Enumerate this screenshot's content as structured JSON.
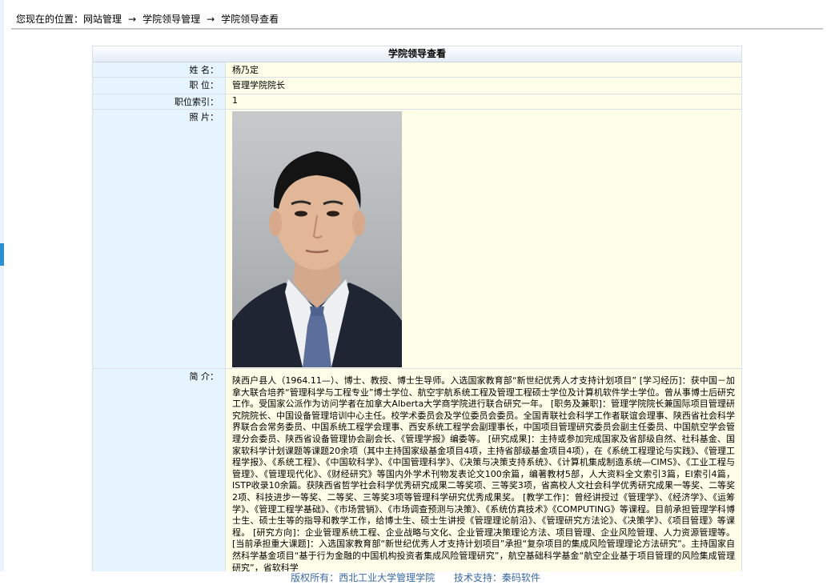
{
  "breadcrumb": {
    "prefix": "您现在的位置：",
    "items": [
      "网站管理",
      "学院领导管理",
      "学院领导查看"
    ],
    "separator": "→"
  },
  "panel": {
    "title": "学院领导查看",
    "fields": {
      "name_label": "姓    名：",
      "name_value": "杨乃定",
      "position_label": "职    位：",
      "position_value": "管理学院院长",
      "index_label": "职位索引：",
      "index_value": "1",
      "photo_label": "照    片：",
      "intro_label": "简    介：",
      "intro_value": "陕西户县人（1964.11—）、博士、教授、博士生导师。入选国家教育部“新世纪优秀人才支持计划项目” [学习经历]：获中国－加拿大联合培养“管理科学与工程专业”博士学位、航空宇航系统工程及管理工程硕士学位及计算机软件学士学位。曾从事博士后研究工作。受国家公派作为访问学者在加拿大Alberta大学商学院进行联合研究一年。 [职务及兼职]：管理学院院长兼国际项目管理研究院院长、中国设备管理培训中心主任。校学术委员会及学位委员会委员。全国青联社会科学工作者联谊会理事、陕西省社会科学界联合会常务委员、中国系统工程学会理事、西安系统工程学会副理事长，中国项目管理研究委员会副主任委员、中国航空学会管理分会委员、陕西省设备管理协会副会长、《管理学报》编委等。 [研究成果]：主持或参加完成国家及省部级自然、社科基金、国家软科学计划课题等课题20余项（其中主持国家级基金项目4项，主持省部级基金项目4项），在《系统工程理论与实践》、《管理工程学报》、《系统工程》、《中国软科学》、《中国管理科学》、《决策与决策支持系统》、《计算机集成制造系统—CIMS》、《工业工程与管理》、《管理现代化》、《财经研究》等国内外学术刊物发表论文100余篇，编著教材5部，人大资料全文索引3篇，EI索引4篇，ISTP收录10余篇。获陕西省哲学社会科学优秀研究成果二等奖项、三等奖3项，省高校人文社会科学优秀研究成果一等奖、二等奖2项、科技进步一等奖、二等奖、三等奖3项等管理科学研究优秀成果奖。 [教学工作]：曾经讲授过《管理学》、《经济学》、《运筹学》、《管理工程学基础》、《市场营销》、《市场调查预测与决策》、《系统仿真技术》《COMPUTING》等课程。目前承担管理学科博士生、硕士生等的指导和教学工作，给博士生、硕士生讲授《管理理论前沿》、《管理研究方法论》、《决策学》、《项目管理》等课程。 [研究方向]：企业管理系统工程、企业战略与文化、企业管理决策理论方法、项目管理、企业风险管理、人力资源管理等。 [当前承担重大课题]：入选国家教育部“新世纪优秀人才支持计划项目”承担“复杂项目的集成风险管理理论方法研究”。主持国家自然科学基金项目“基于行为金融的中国机构投资者集成风险管理研究”，航空基础科学基金“航空企业基于项目管理的风险集成管理研究”，省软科学"
    }
  },
  "footer": {
    "copyright": "版权所有：西北工业大学管理学院",
    "support": "技术支持：秦码软件"
  },
  "colors": {
    "label_bg": "#e6f4fd",
    "value_bg": "#fffee8",
    "footer_text": "#3b6aa0"
  }
}
